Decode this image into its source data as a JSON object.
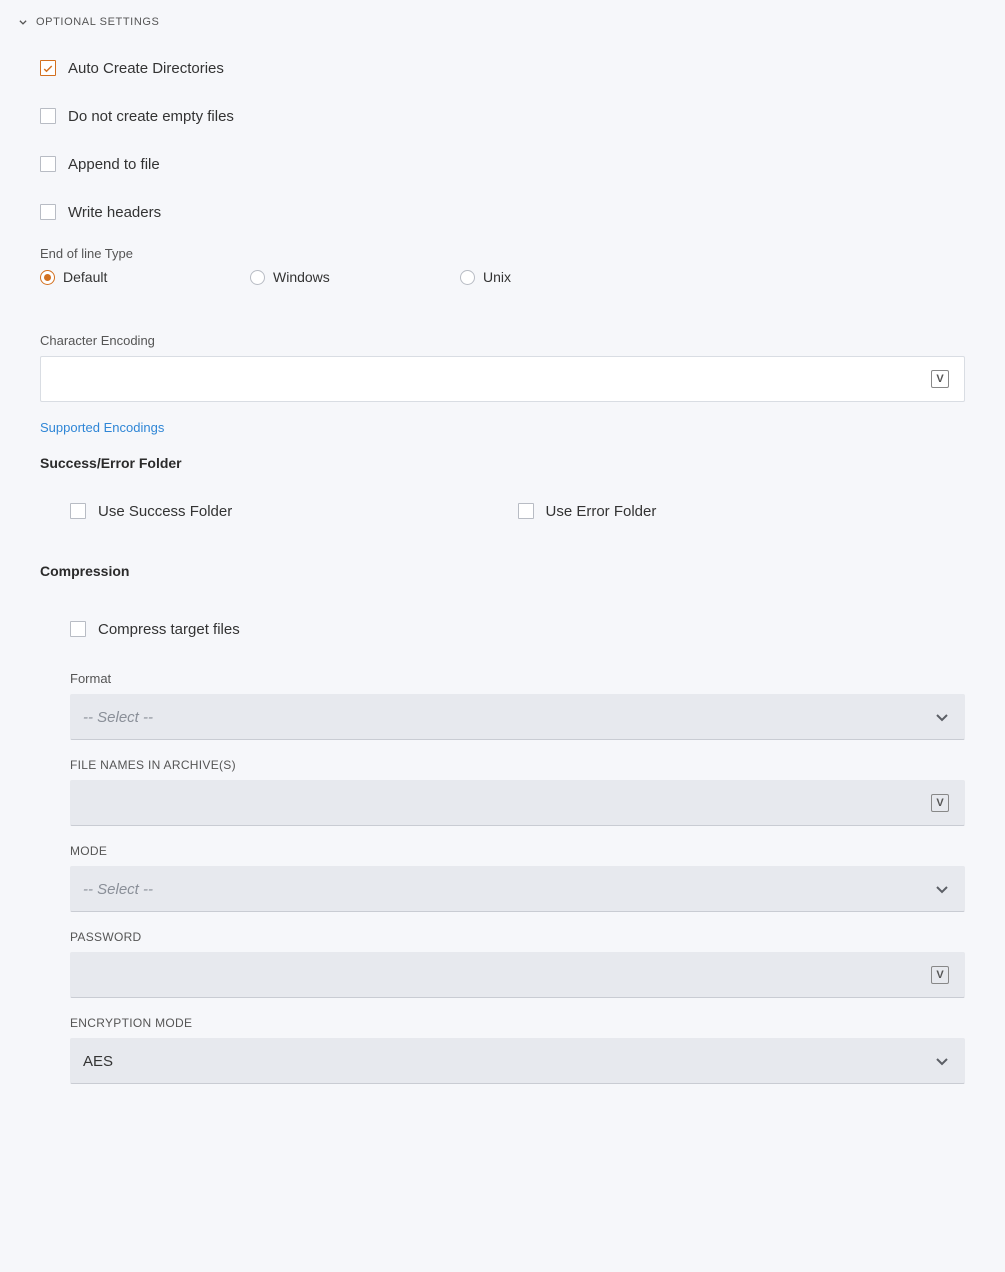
{
  "header": {
    "title": "Optional Settings"
  },
  "checks": {
    "auto_create": "Auto Create Directories",
    "no_empty": "Do not create empty files",
    "append": "Append to file",
    "headers": "Write headers"
  },
  "eol": {
    "label": "End of line Type",
    "options": {
      "default": "Default",
      "windows": "Windows",
      "unix": "Unix"
    }
  },
  "encoding": {
    "label": "Character Encoding",
    "value": "",
    "link": "Supported Encodings"
  },
  "folders": {
    "title": "Success/Error Folder",
    "success": "Use Success Folder",
    "error": "Use Error Folder"
  },
  "compression": {
    "title": "Compression",
    "enable": "Compress target files",
    "format_label": "Format",
    "format_placeholder": "-- Select --",
    "filenames_label": "File Names in Archive(s)",
    "filenames_value": "",
    "mode_label": "Mode",
    "mode_placeholder": "-- Select --",
    "password_label": "Password",
    "password_value": "",
    "enc_label": "Encryption Mode",
    "enc_value": "AES"
  },
  "glyph": {
    "v": "V"
  }
}
